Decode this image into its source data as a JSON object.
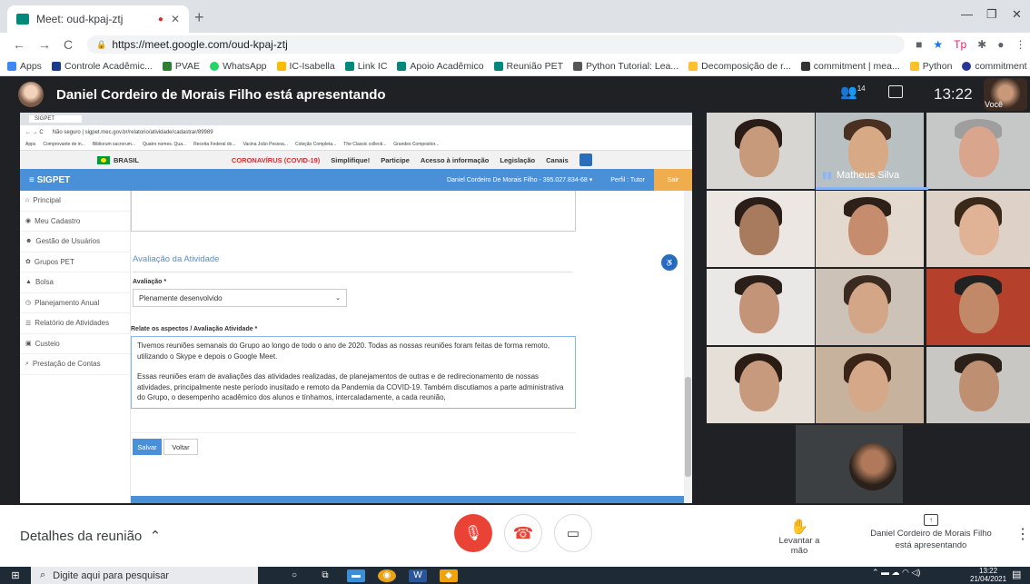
{
  "browser": {
    "tab_title": "Meet: oud-kpaj-ztj",
    "url": "https://meet.google.com/oud-kpaj-ztj",
    "bookmarks": [
      "Apps",
      "Controle Acadêmic...",
      "PVAE",
      "WhatsApp",
      "IC-Isabella",
      "Link IC",
      "Apoio Acadêmico",
      "Reunião PET",
      "Python Tutorial: Lea...",
      "Decomposição de r...",
      "commitment | mea...",
      "Python",
      "commitment noun..."
    ]
  },
  "meet": {
    "presenting_text": "Daniel Cordeiro de Morais Filho está apresentando",
    "participant_count": "14",
    "time": "13:22",
    "self_label": "Você",
    "active_speaker": "Matheus Silva",
    "details_label": "Detalhes da reunião",
    "raise_hand_label": "Levantar a mão",
    "presenting_footer_line1": "Daniel Cordeiro de Morais Filho",
    "presenting_footer_line2": "está apresentando"
  },
  "shared_screen": {
    "tab_title": "SIGPET",
    "url": "Não seguro | sigpet.mec.gov.br/relatorio/atividade/cadastrar/89989",
    "bookmarks": [
      "Apps",
      "Comprovante de in...",
      "Bibliorum sacrorum...",
      "Quatro nomes. Qua...",
      "Receita Federal do...",
      "Vacina João Pessoa...",
      "Coleção Completa...",
      "The Classic collecti...",
      "Grandes Compositor..."
    ],
    "gov_bar": {
      "country": "BRASIL",
      "covid": "CORONAVÍRUS (COVID-19)",
      "links": [
        "Simplifique!",
        "Participe",
        "Acesso à informação",
        "Legislação",
        "Canais"
      ]
    },
    "header": {
      "brand": "≡  SIGPET",
      "user": "Daniel Cordeiro De Morais Filho - 395.027.834-68 ▾",
      "profile": "Perfil : Tutor",
      "logout": "Sair"
    },
    "sidebar": [
      "Principal",
      "Meu Cadastro",
      "Gestão de Usuários",
      "Grupos PET",
      "Bolsa",
      "Planejamento Anual",
      "Relatório de Atividades",
      "Custeio",
      "Prestação de Contas"
    ],
    "section_title": "Avaliação da Atividade",
    "avaliacao_label": "Avaliação *",
    "avaliacao_value": "Plenamente desenvolvido",
    "relate_label": "Relate os aspectos / Avaliação Atividade *",
    "text_p1": "Tivemos reuniões semanais do Grupo ao longo de todo o ano de 2020. Todas as nossas reuniões foram feitas de forma remoto, utilizando o Skype e depois o Google Meet.",
    "text_p2": "Essas reuniões eram de avaliações das atividades realizadas, de planejamentos de outras e de redirecionamento de nossas atividades, principalmente neste período inusitado e remoto da Pandemia da COVID-19. Também discutiamos a parte administrativa do Grupo, o desempenho acadêmico dos alunos e tínhamos, intercaladamente, a cada reunião,",
    "save_label": "Salvar",
    "back_label": "Voltar"
  },
  "taskbar": {
    "search_placeholder": "Digite aqui para pesquisar",
    "time": "13:22",
    "date": "21/04/2021"
  },
  "colors": {
    "meet_bg": "#202124",
    "sigpet_blue": "#4a90d9",
    "hangup_red": "#ea4335",
    "accent": "#8ab4f8"
  }
}
